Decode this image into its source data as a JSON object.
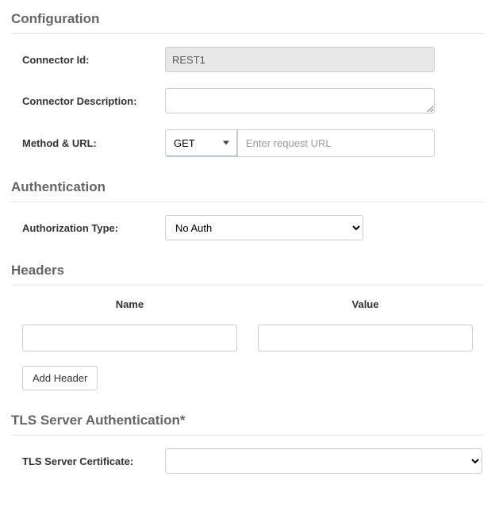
{
  "configuration": {
    "title": "Configuration",
    "connector_id_label": "Connector Id:",
    "connector_id_value": "REST1",
    "connector_desc_label": "Connector Description:",
    "connector_desc_value": "",
    "method_url_label": "Method & URL:",
    "method_value": "GET",
    "url_value": "",
    "url_placeholder": "Enter request URL"
  },
  "authentication": {
    "title": "Authentication",
    "auth_type_label": "Authorization Type:",
    "auth_type_value": "No Auth"
  },
  "headers": {
    "title": "Headers",
    "name_col": "Name",
    "value_col": "Value",
    "name_value": "",
    "value_value": "",
    "add_button": "Add Header"
  },
  "tls": {
    "title": "TLS Server Authentication*",
    "cert_label": "TLS Server Certificate:",
    "cert_value": ""
  }
}
